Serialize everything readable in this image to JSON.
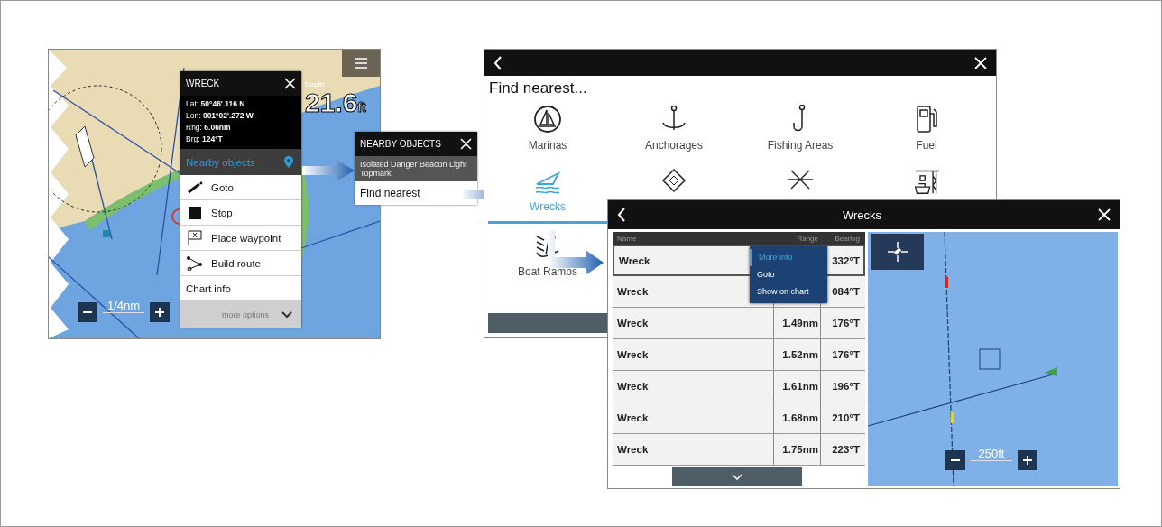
{
  "chart_screen": {
    "depth": {
      "label": "Depth",
      "value": "21.6",
      "unit": "ft"
    },
    "scale": "1/4nm",
    "wreck_popup": {
      "title": "WRECK",
      "details": [
        "Lat: **50°46'.116 N**",
        "Lon: **001°02'.272 W**",
        "Rng: **6.06nm**",
        "Brg: **124°T**"
      ],
      "nearby_objects": "Nearby objects",
      "actions": [
        {
          "kind": "goto",
          "label": "Goto"
        },
        {
          "kind": "stop",
          "label": "Stop"
        },
        {
          "kind": "waypoint",
          "label": "Place waypoint"
        },
        {
          "kind": "route",
          "label": "Build route"
        },
        {
          "kind": "plain",
          "label": "Chart info"
        }
      ],
      "more_options": "more options"
    }
  },
  "nearby_popup": {
    "title": "NEARBY OBJECTS",
    "items": [
      {
        "label": "Isolated Danger Beacon Light Topmark",
        "selected": true
      },
      {
        "label": "Find nearest",
        "selected": false
      }
    ]
  },
  "find_nearest": {
    "title": "Find nearest...",
    "categories": [
      {
        "kind": "marina",
        "label": "Marinas",
        "selected": false
      },
      {
        "kind": "anchor",
        "label": "Anchorages",
        "selected": false
      },
      {
        "kind": "hook",
        "label": "Fishing Areas",
        "selected": false
      },
      {
        "kind": "fuel",
        "label": "Fuel",
        "selected": false
      },
      {
        "kind": "wreck",
        "label": "Wrecks",
        "selected": true
      },
      {
        "kind": "beacon",
        "selected": false
      },
      {
        "kind": "star",
        "selected": false
      },
      {
        "kind": "dock",
        "selected": false
      },
      {
        "kind": "ramp",
        "label": "Boat Ramps",
        "selected": false
      }
    ]
  },
  "wrecks": {
    "title": "Wrecks",
    "columns": [
      "Name",
      "Range",
      "Bearing"
    ],
    "rows": [
      {
        "name": "Wreck",
        "bearing": "332°T",
        "selected": true
      },
      {
        "name": "Wreck",
        "bearing": "084°T",
        "selected": false
      },
      {
        "name": "Wreck",
        "range": "1.49nm",
        "bearing": "176°T",
        "selected": false
      },
      {
        "name": "Wreck",
        "range": "1.52nm",
        "bearing": "176°T",
        "selected": false
      },
      {
        "name": "Wreck",
        "range": "1.61nm",
        "bearing": "196°T",
        "selected": false
      },
      {
        "name": "Wreck",
        "range": "1.68nm",
        "bearing": "210°T",
        "selected": false
      },
      {
        "name": "Wreck",
        "range": "1.75nm",
        "bearing": "223°T",
        "selected": false
      }
    ],
    "context_menu": [
      {
        "label": "More info",
        "selected": true
      },
      {
        "label": "Goto",
        "selected": false
      },
      {
        "label": "Show on chart",
        "selected": false
      }
    ],
    "scale": "250ft"
  }
}
